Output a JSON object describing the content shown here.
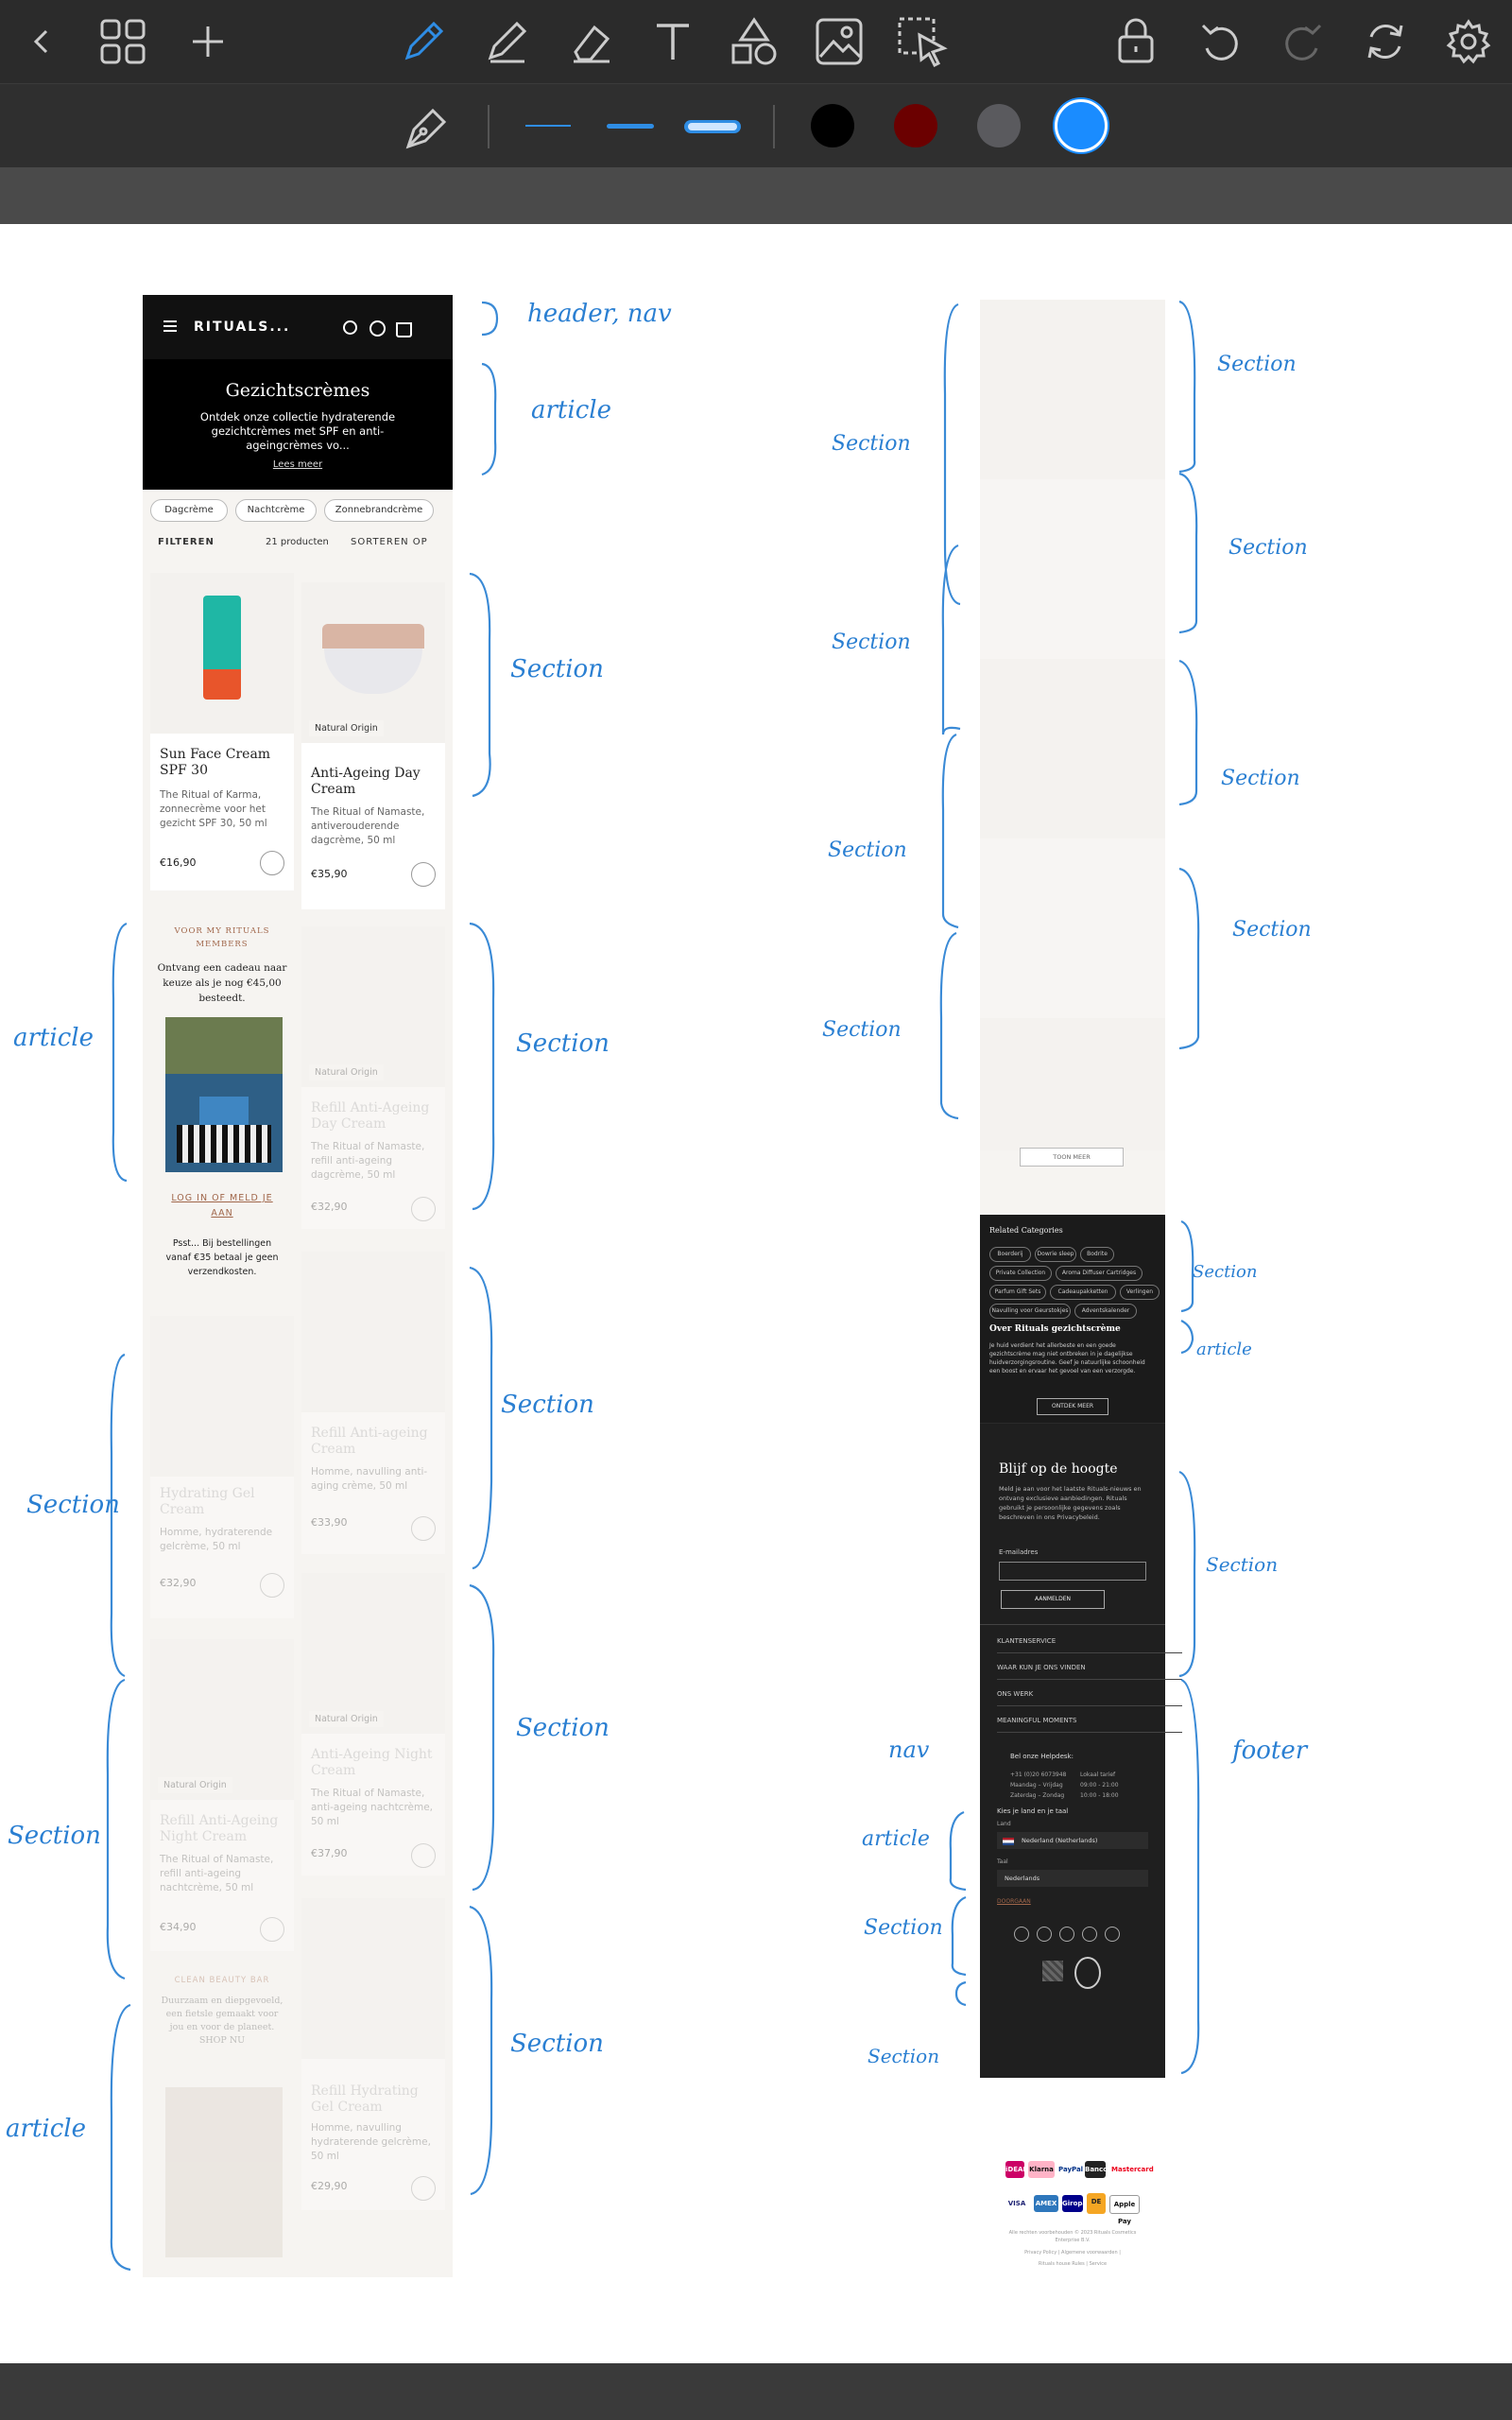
{
  "toolbar": {
    "icons": [
      "back-icon",
      "grid-icon",
      "plus-icon",
      "pen-icon",
      "pencil-icon",
      "eraser-icon",
      "text-icon",
      "shapes-icon",
      "image-icon",
      "lasso-select-icon",
      "lock-icon",
      "undo-icon",
      "redo-icon",
      "sync-icon",
      "gear-icon"
    ]
  },
  "subbar": {
    "colors": [
      "#000000",
      "#6b0000",
      "#5a5a5e",
      "#1a8cff"
    ]
  },
  "mobile": {
    "brand": "RITUALS...",
    "hero_title": "Gezichtscrèmes",
    "hero_text": "Ontdek onze collectie hydraterende gezichtcrèmes met SPF en anti-ageingcrèmes vo...",
    "hero_link": "Lees meer",
    "pills": [
      "Dagcrème",
      "Nachtcrème",
      "Zonnebrandcrème"
    ],
    "filter_label": "FILTEREN",
    "count": "21 producten",
    "sort_label": "SORTEREN OP",
    "products": [
      {
        "name": "Sun Face Cream SPF 30",
        "desc": "The Ritual of Karma, zonnecrème voor het gezicht SPF 30, 50 ml",
        "price": "€16,90",
        "badge": ""
      },
      {
        "name": "Anti-Ageing Day Cream",
        "desc": "The Ritual of Namaste, antiverouderende dagcrème, 50 ml",
        "price": "€35,90",
        "badge": "Natural Origin"
      },
      {
        "name": "Refill Anti-Ageing Day Cream",
        "desc": "The Ritual of Namaste, refill anti-ageing dagcrème, 50 ml",
        "price": "€32,90",
        "badge": "Natural Origin"
      },
      {
        "name": "Refill Anti-ageing Cream",
        "desc": "Homme, navulling anti-aging crème, 50 ml",
        "price": "€33,90",
        "badge": ""
      },
      {
        "name": "Hydrating Gel Cream",
        "desc": "Homme, hydraterende gelcrème, 50 ml",
        "price": "€32,90",
        "badge": ""
      },
      {
        "name": "Anti-Ageing Night Cream",
        "desc": "The Ritual of Namaste, anti-ageing nachtcrème, 50 ml",
        "price": "€37,90",
        "badge": "Natural Origin"
      },
      {
        "name": "Refill Anti-Ageing Night Cream",
        "desc": "The Ritual of Namaste, refill anti-ageing nachtcrème, 50 ml",
        "price": "€34,90",
        "badge": "Natural Origin"
      },
      {
        "name": "Refill Hydrating Gel Cream",
        "desc": "Homme, navulling hydraterende gelcrème, 50 ml",
        "price": "€29,90",
        "badge": ""
      }
    ],
    "promo_heading": "VOOR MY RITUALS MEMBERS",
    "promo_text": "Ontvang een cadeau naar keuze als je nog €45,00 besteedt.",
    "promo_link": "LOG IN OF MELD JE AAN",
    "promo_note": "Psst... Bij bestellingen vanaf €35 betaal je geen verzendkosten.",
    "promo2_heading": "CLEAN BEAUTY BAR",
    "promo2_text": "Duurzaam en diepgevoeld, een fietsle gemaakt voor jou en voor de planeet. SHOP NU"
  },
  "desktop": {
    "show_more": "TOON MEER",
    "related_title": "Related Categories",
    "tags": [
      "Boerderij",
      "Dowrie sleep",
      "Bodrite",
      "Private Collection",
      "Aroma Diffuser Cartridges",
      "Parfum Gift Sets",
      "Cadeaupakketten",
      "Verlingen",
      "Navulling voor Geurstokjes",
      "Adventskalender"
    ],
    "about_title": "Over Rituals gezichtscrème",
    "about_text": "Je huid verdient het allerbeste en een goede gezichtscrème mag niet ontbreken in je dagelijkse huidverzorgingsroutine. Geef je natuurlijke schoonheid een boost en ervaar het gevoel van een verzorgde.",
    "discover": "ONTDEK MEER",
    "newsletter_title": "Blijf op de hoogte",
    "newsletter_text": "Meld je aan voor het laatste Rituals-nieuws en ontvang exclusieve aanbiedingen. Rituals gebruikt je persoonlijke gegevens zoals beschreven in ons Privacybeleid.",
    "email_label": "E-mailadres",
    "signup": "AANMELDEN",
    "footer_rows": [
      "KLANTENSERVICE",
      "WAAR KUN JE ONS VINDEN",
      "ONS WERK",
      "MEANINGFUL MOMENTS"
    ],
    "helpdesk_title": "Bel onze Helpdesk:",
    "helpdesk_lines": [
      "+31 (0)20 6073948",
      "Maandag – Vrijdag",
      "Zaterdag – Zondag"
    ],
    "helpdesk_right": [
      "Lokaal tarief",
      "09:00 - 21:00",
      "10:00 - 18:00"
    ],
    "country_title": "Kies je land en je taal",
    "country_label": "Land",
    "country_value": "Nederland (Netherlands)",
    "lang_label": "Taal",
    "lang_value": "Nederlands",
    "doorgaan": "DOORGAAN",
    "legal1": "Alle rechten voorbehouden © 2023 Rituals Cosmetics Enterprise B.V.",
    "legal2": "Privacy Policy | Algemene voorwaarden |",
    "legal3": "Rituals house Rules | Service",
    "payments": [
      "iDEAL",
      "Klarna",
      "PayPal",
      "Bancontact",
      "Mastercard",
      "VISA",
      "AMEX",
      "Giropay",
      "DE",
      "Apple Pay"
    ]
  },
  "annotations": {
    "header_nav": "header, nav",
    "article": "article",
    "section": "Section",
    "nav": "nav",
    "footer": "footer"
  }
}
